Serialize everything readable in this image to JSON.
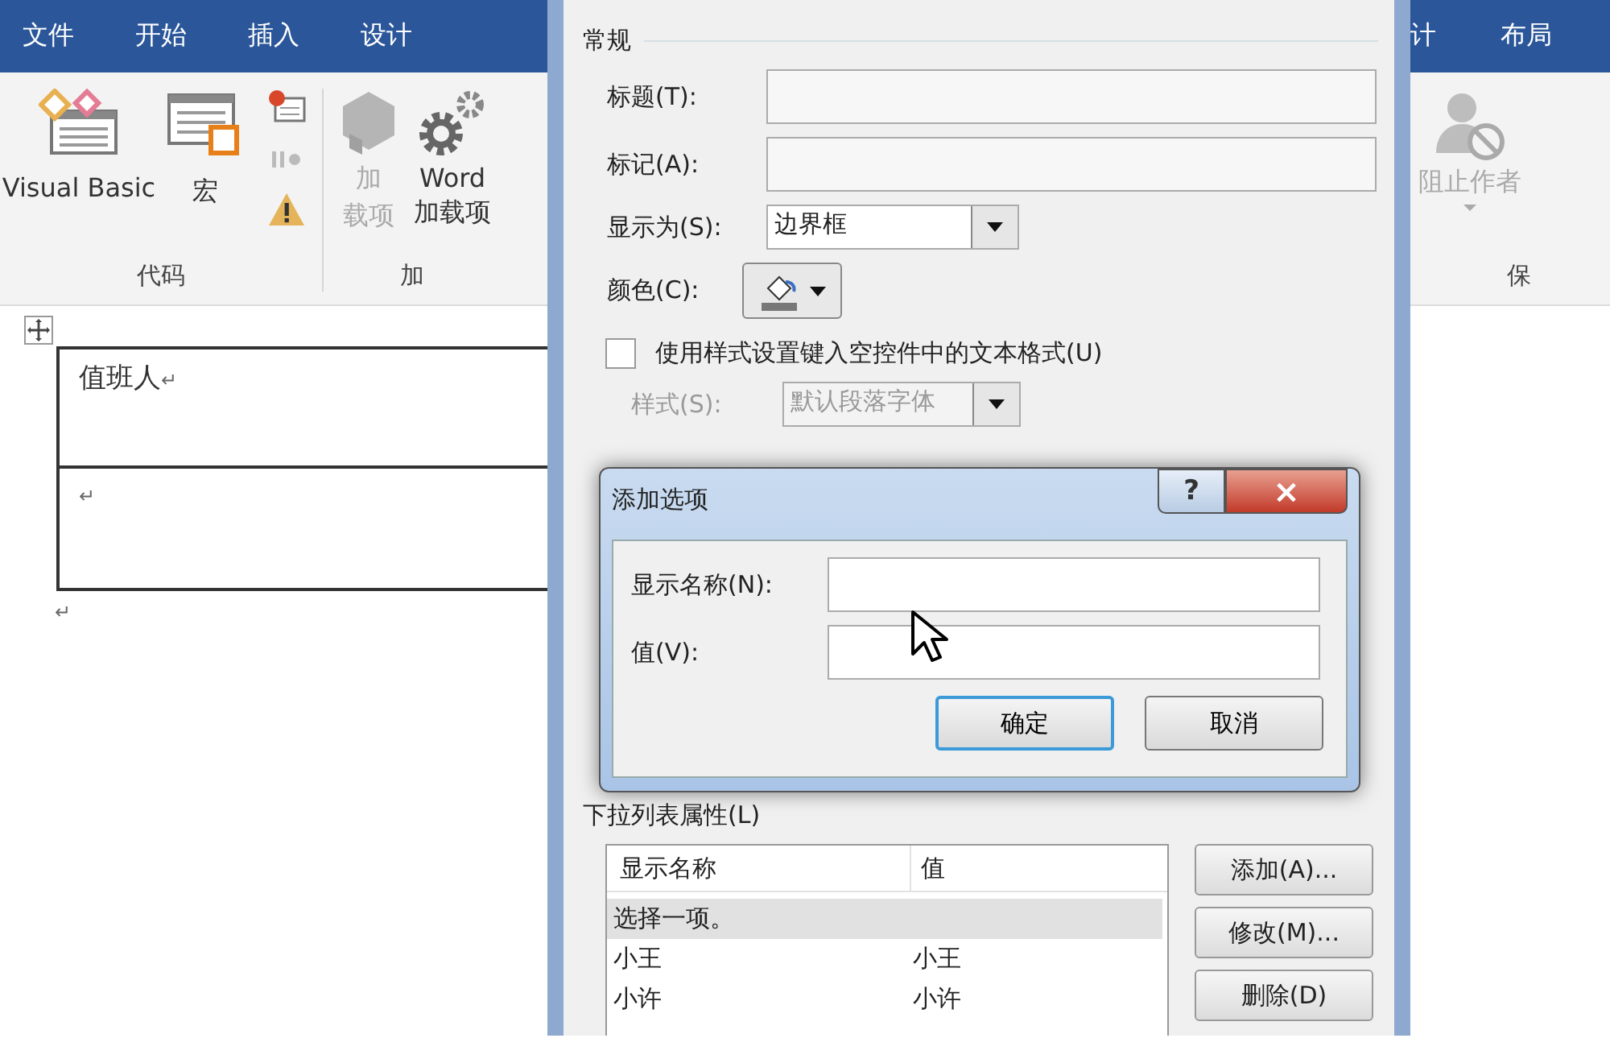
{
  "word": {
    "tabs_left": [
      "文件",
      "开始",
      "插入",
      "设计"
    ],
    "tabs_right": [
      "计",
      "布局"
    ],
    "code_group": {
      "label": "代码",
      "big_buttons": [
        {
          "kind": "vb",
          "label": "Visual Basic"
        },
        {
          "kind": "macro",
          "label": "宏"
        }
      ]
    },
    "addin_group": {
      "label": "加",
      "buttons": [
        {
          "kind": "cube",
          "lines": [
            "加",
            "载项"
          ],
          "disabled": true
        },
        {
          "kind": "gears",
          "lines": [
            "Word",
            "加载项"
          ],
          "disabled": false
        }
      ]
    },
    "protect_group": {
      "label": "保",
      "buttons": [
        {
          "kind": "block",
          "label": "阻止作者",
          "disabled": true
        }
      ]
    },
    "table": {
      "cells": [
        {
          "text": "值班人",
          "mark": "↵"
        },
        {
          "mark": "↵"
        }
      ],
      "after_mark": "↵"
    }
  },
  "dialog": {
    "section": "常规",
    "title_label": "标题(T):",
    "tag_label": "标记(A):",
    "show_as": {
      "label": "显示为(S):",
      "value": "边界框"
    },
    "color_label": "颜色(C):",
    "use_style": {
      "label": "使用样式设置键入空控件中的文本格式(U)",
      "checked": false
    },
    "style": {
      "label": "样式(S):",
      "value": "默认段落字体",
      "disabled": true
    },
    "list_section": "下拉列表属性(L)",
    "columns": [
      "显示名称",
      "值"
    ],
    "rows": [
      {
        "name": "选择一项。",
        "selected": true
      },
      {
        "name": "小王",
        "value": "小王",
        "selected": false
      },
      {
        "name": "小许",
        "value": "小许",
        "selected": false
      }
    ],
    "buttons": [
      "添加(A)...",
      "修改(M)...",
      "删除(D)"
    ]
  },
  "modal": {
    "title": "添加选项",
    "help": "?",
    "close": "×",
    "fields": [
      {
        "label": "显示名称(N):"
      },
      {
        "label": "值(V):"
      }
    ],
    "buttons": [
      {
        "label": "确定",
        "default": true
      },
      {
        "label": "取消",
        "default": false
      }
    ]
  }
}
